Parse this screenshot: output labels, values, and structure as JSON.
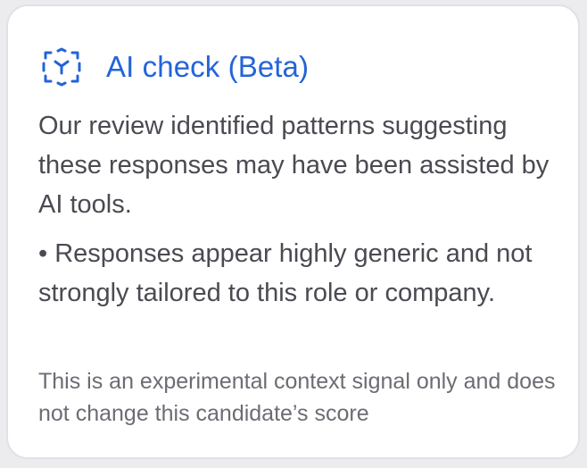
{
  "card": {
    "icon": "ai-scan-icon",
    "title": "AI check (Beta)",
    "paragraph": "Our review identified patterns suggesting these responses may have been assisted by AI tools.",
    "findings": [
      "• Responses appear highly generic and not strongly tailored to this role or company."
    ],
    "footnote": "This is an experimental context signal only and does not change this candidate’s score"
  },
  "colors": {
    "accent": "#2364d8",
    "body_text": "#4a4a52",
    "muted_text": "#6c6c74",
    "card_border": "#e1e1e6",
    "background": "#ececee"
  }
}
